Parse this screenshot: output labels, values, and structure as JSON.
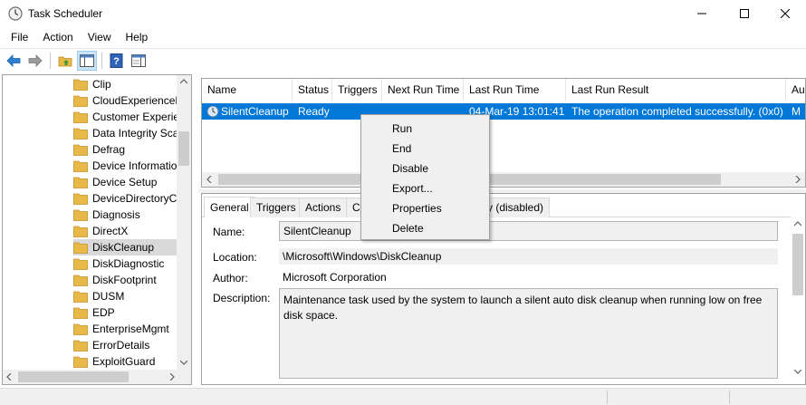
{
  "window": {
    "title": "Task Scheduler",
    "minimize_icon": "minimize-icon",
    "maximize_icon": "maximize-icon",
    "close_icon": "close-icon"
  },
  "menubar": {
    "items": [
      "File",
      "Action",
      "View",
      "Help"
    ]
  },
  "toolbar": {
    "icons": [
      "back-arrow-icon",
      "forward-arrow-icon",
      "up-folder-icon",
      "show-hide-console-tree-icon",
      "help-icon",
      "action-pane-icon"
    ]
  },
  "tree": {
    "items": [
      {
        "label": "Clip"
      },
      {
        "label": "CloudExperienceH"
      },
      {
        "label": "Customer Experie"
      },
      {
        "label": "Data Integrity Sca"
      },
      {
        "label": "Defrag"
      },
      {
        "label": "Device Informatio"
      },
      {
        "label": "Device Setup"
      },
      {
        "label": "DeviceDirectoryC"
      },
      {
        "label": "Diagnosis"
      },
      {
        "label": "DirectX"
      },
      {
        "label": "DiskCleanup",
        "selected": true
      },
      {
        "label": "DiskDiagnostic"
      },
      {
        "label": "DiskFootprint"
      },
      {
        "label": "DUSM"
      },
      {
        "label": "EDP"
      },
      {
        "label": "EnterpriseMgmt"
      },
      {
        "label": "ErrorDetails"
      },
      {
        "label": "ExploitGuard"
      }
    ]
  },
  "tasklist": {
    "columns": [
      "Name",
      "Status",
      "Triggers",
      "Next Run Time",
      "Last Run Time",
      "Last Run Result",
      "Au"
    ],
    "rows": [
      {
        "name": "SilentCleanup",
        "status": "Ready",
        "triggers": "",
        "next_run": "",
        "last_run": "04-Mar-19 13:01:41",
        "result": "The operation completed successfully. (0x0)",
        "author": "M"
      }
    ]
  },
  "context_menu": {
    "items": [
      "Run",
      "End",
      "Disable",
      "Export...",
      "Properties",
      "Delete"
    ]
  },
  "details": {
    "tabs": [
      "General",
      "Triggers",
      "Actions",
      "Co",
      "ry (disabled)"
    ],
    "name_label": "Name:",
    "name_value": "SilentCleanup",
    "location_label": "Location:",
    "location_value": "\\Microsoft\\Windows\\DiskCleanup",
    "author_label": "Author:",
    "author_value": "Microsoft Corporation",
    "description_label": "Description:",
    "description_line1": "Maintenance task used by the system to launch a silent auto disk cleanup when running low on free",
    "description_line2": "disk space."
  },
  "colors": {
    "selection": "#0078d7",
    "menu_bg": "#f0f0f0",
    "folder": "#e8b949"
  }
}
